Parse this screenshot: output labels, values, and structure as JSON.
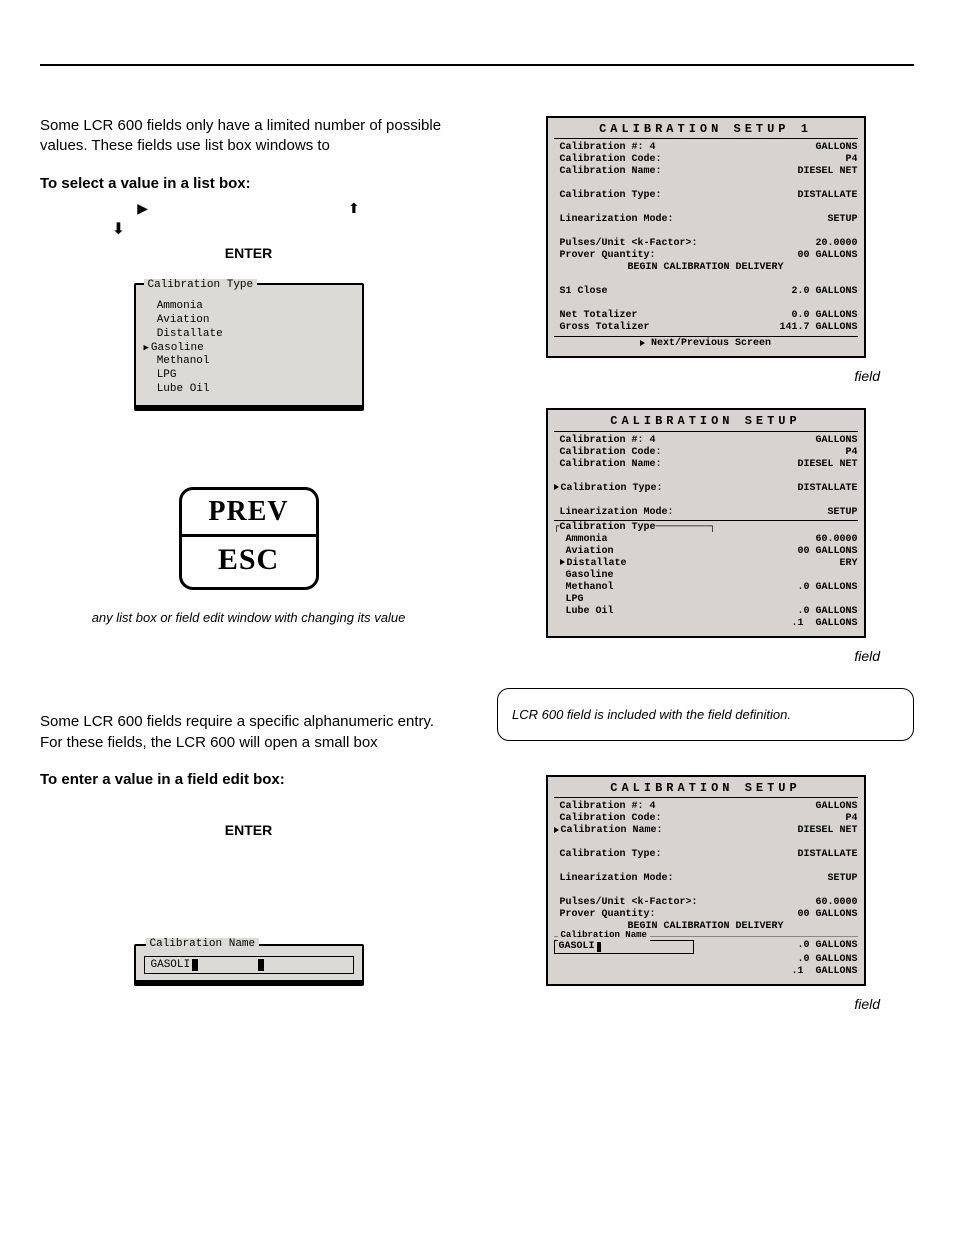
{
  "top": {
    "para_listbox_intro": "Some LCR 600 fields only have a limited number of possible values. These fields use list box windows to",
    "head_listbox": "To select a value in a list box:",
    "enter_label": "ENTER",
    "big_btn_top": "PREV",
    "big_btn_bot": "ESC",
    "caption_prev_esc": "any list box or field edit window with changing its value",
    "para_editbox_intro": "Some LCR 600 fields require a specific alphanumeric entry. For these fields, the LCR 600 will open a small box",
    "head_editbox": "To enter a value in a field edit box:"
  },
  "listbox": {
    "title": "Calibration Type",
    "items": [
      "Ammonia",
      "Aviation",
      "Distallate",
      "Gasoline",
      "Methanol",
      "LPG",
      "Lube Oil"
    ],
    "selected_index": 3
  },
  "editbox": {
    "title": "Calibration Name",
    "value": "GASOLI"
  },
  "panel1": {
    "title": "CALIBRATION  SETUP 1",
    "rows": [
      [
        "Calibration #: 4",
        "GALLONS"
      ],
      [
        "Calibration Code:",
        "P4"
      ],
      [
        "Calibration Name:",
        "DIESEL NET"
      ],
      [
        "",
        ""
      ],
      [
        "Calibration Type:",
        "DISTALLATE"
      ],
      [
        "",
        ""
      ],
      [
        "Linearization Mode:",
        "SETUP"
      ],
      [
        "",
        ""
      ],
      [
        "Pulses/Unit <k-Factor>:",
        "20.0000"
      ],
      [
        "Prover Quantity:",
        "00 GALLONS"
      ]
    ],
    "center1": "BEGIN CALIBRATION DELIVERY",
    "rows2": [
      [
        "",
        ""
      ],
      [
        "S1 Close",
        "2.0 GALLONS"
      ],
      [
        "",
        ""
      ],
      [
        "Net Totalizer",
        "0.0 GALLONS"
      ],
      [
        "Gross Totalizer",
        "141.7 GALLONS"
      ]
    ],
    "footer": "Next/Previous Screen"
  },
  "panel2": {
    "title": "CALIBRATION  SETUP",
    "rows": [
      [
        "Calibration #: 4",
        "GALLONS"
      ],
      [
        "Calibration Code:",
        "P4"
      ],
      [
        "Calibration Name:",
        "DIESEL NET"
      ],
      [
        "",
        ""
      ],
      [
        "Calibration Type:",
        "DISTALLATE",
        true
      ],
      [
        "",
        ""
      ],
      [
        "Linearization Mode:",
        "SETUP"
      ]
    ],
    "sub_title": "Calibration Type",
    "sub_rows": [
      [
        "Ammonia",
        "60.0000"
      ],
      [
        "Aviation",
        "00 GALLONS"
      ],
      [
        "Distallate",
        "ERY",
        true
      ],
      [
        "Gasoline",
        ""
      ],
      [
        "Methanol",
        ".0 GALLONS"
      ],
      [
        "LPG",
        ""
      ],
      [
        "Lube Oil",
        ".0 GALLONS"
      ]
    ],
    "tail_row": [
      "",
      ".1  GALLONS"
    ]
  },
  "panel3": {
    "title": "CALIBRATION  SETUP",
    "rows": [
      [
        "Calibration #: 4",
        "GALLONS"
      ],
      [
        "Calibration Code:",
        "P4"
      ],
      [
        "Calibration Name:",
        "DIESEL NET",
        true
      ],
      [
        "",
        ""
      ],
      [
        "Calibration Type:",
        "DISTALLATE"
      ],
      [
        "",
        ""
      ],
      [
        "Linearization Mode:",
        "SETUP"
      ],
      [
        "",
        ""
      ],
      [
        "Pulses/Unit <k-Factor>:",
        "60.0000"
      ],
      [
        "Prover Quantity:",
        "00 GALLONS"
      ]
    ],
    "center1": "BEGIN CALIBRATION DELIVERY",
    "edit_label": "Calibration Name",
    "edit_val": "GASOLI",
    "right_of_edit_top": ".0 GALLONS",
    "tail_rows": [
      [
        "",
        ".0 GALLONS"
      ],
      [
        "",
        ".1  GALLONS"
      ]
    ]
  },
  "captions": {
    "field": "field",
    "note": "LCR 600 field is included with the field definition."
  }
}
